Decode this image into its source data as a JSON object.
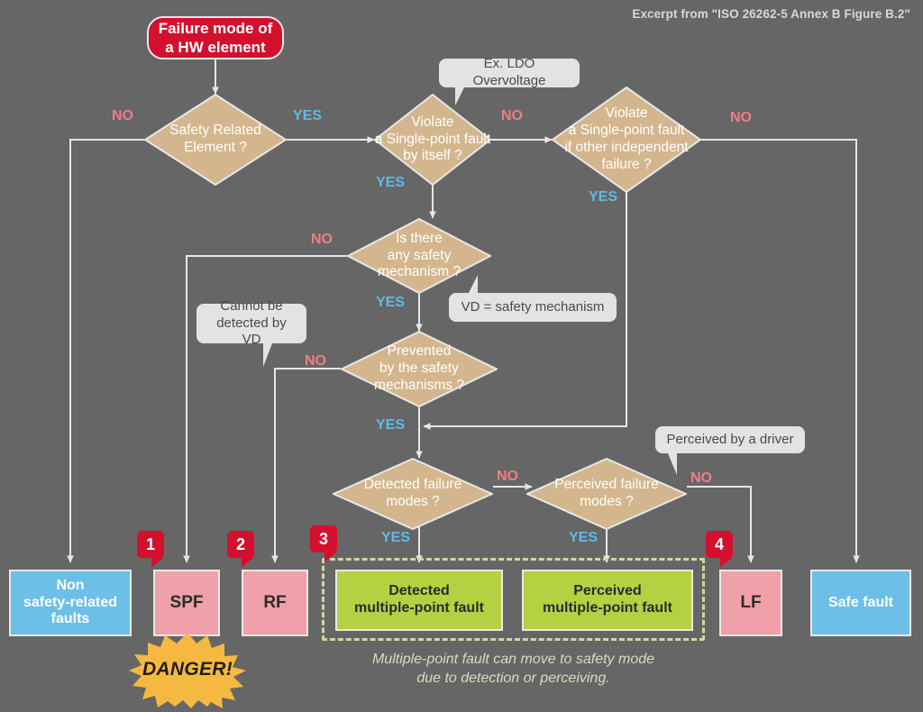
{
  "meta": {
    "credit": "Excerpt from \"ISO 26262-5 Annex B Figure B.2\"",
    "bg_color": "#666666",
    "diamond_color": "#d3b68d",
    "wire_color": "#e6e6e6",
    "no_color": "#f07d85",
    "yes_color": "#5fbbe5"
  },
  "start": {
    "label": "Failure mode of\na HW element",
    "color": "#d3102e"
  },
  "decisions": [
    {
      "id": "d1",
      "label": "Safety Related\nElement ?"
    },
    {
      "id": "d2",
      "label": "Violate\na Single-point fault\nby itself ?"
    },
    {
      "id": "d3",
      "label": "Violate\na Single-point fault\nif other independent\nfailure ?"
    },
    {
      "id": "d4",
      "label": "Is there\nany safety\nmechanism ?"
    },
    {
      "id": "d5",
      "label": "Prevented\nby the safety\nmechanisms ?"
    },
    {
      "id": "d6",
      "label": "Detected failure\nmodes ?"
    },
    {
      "id": "d7",
      "label": "Perceived failure\nmodes ?"
    }
  ],
  "edge_labels": {
    "d1_no": "NO",
    "d1_yes": "YES",
    "d2_no": "NO",
    "d2_yes": "YES",
    "d3_no": "NO",
    "d3_yes": "YES",
    "d4_no": "NO",
    "d4_yes": "YES",
    "d5_no": "NO",
    "d5_yes": "YES",
    "d6_no": "NO",
    "d6_yes": "YES",
    "d7_no": "NO",
    "d7_yes": "YES"
  },
  "callouts": [
    {
      "id": "c1",
      "text": "Ex. LDO Overvoltage"
    },
    {
      "id": "c2",
      "text": "VD = safety mechanism"
    },
    {
      "id": "c3",
      "text": "Cannot be\ndetected by VD"
    },
    {
      "id": "c4",
      "text": "Perceived by a driver"
    }
  ],
  "terminals": [
    {
      "id": "t1",
      "label": "Non\nsafety-related\nfaults",
      "kind": "blue"
    },
    {
      "id": "t2",
      "label": "SPF",
      "kind": "pink"
    },
    {
      "id": "t3",
      "label": "RF",
      "kind": "pink"
    },
    {
      "id": "t4",
      "label": "Detected\nmultiple-point fault",
      "kind": "green"
    },
    {
      "id": "t5",
      "label": "Perceived\nmultiple-point fault",
      "kind": "green"
    },
    {
      "id": "t6",
      "label": "LF",
      "kind": "pink"
    },
    {
      "id": "t7",
      "label": "Safe fault",
      "kind": "blue"
    }
  ],
  "badges": [
    {
      "id": "b1",
      "label": "1"
    },
    {
      "id": "b2",
      "label": "2"
    },
    {
      "id": "b3",
      "label": "3"
    },
    {
      "id": "b4",
      "label": "4"
    }
  ],
  "danger": {
    "label": "DANGER!",
    "color": "#f5b942"
  },
  "group_note": "Multiple-point fault can move to safety mode\ndue to detection or perceiving."
}
